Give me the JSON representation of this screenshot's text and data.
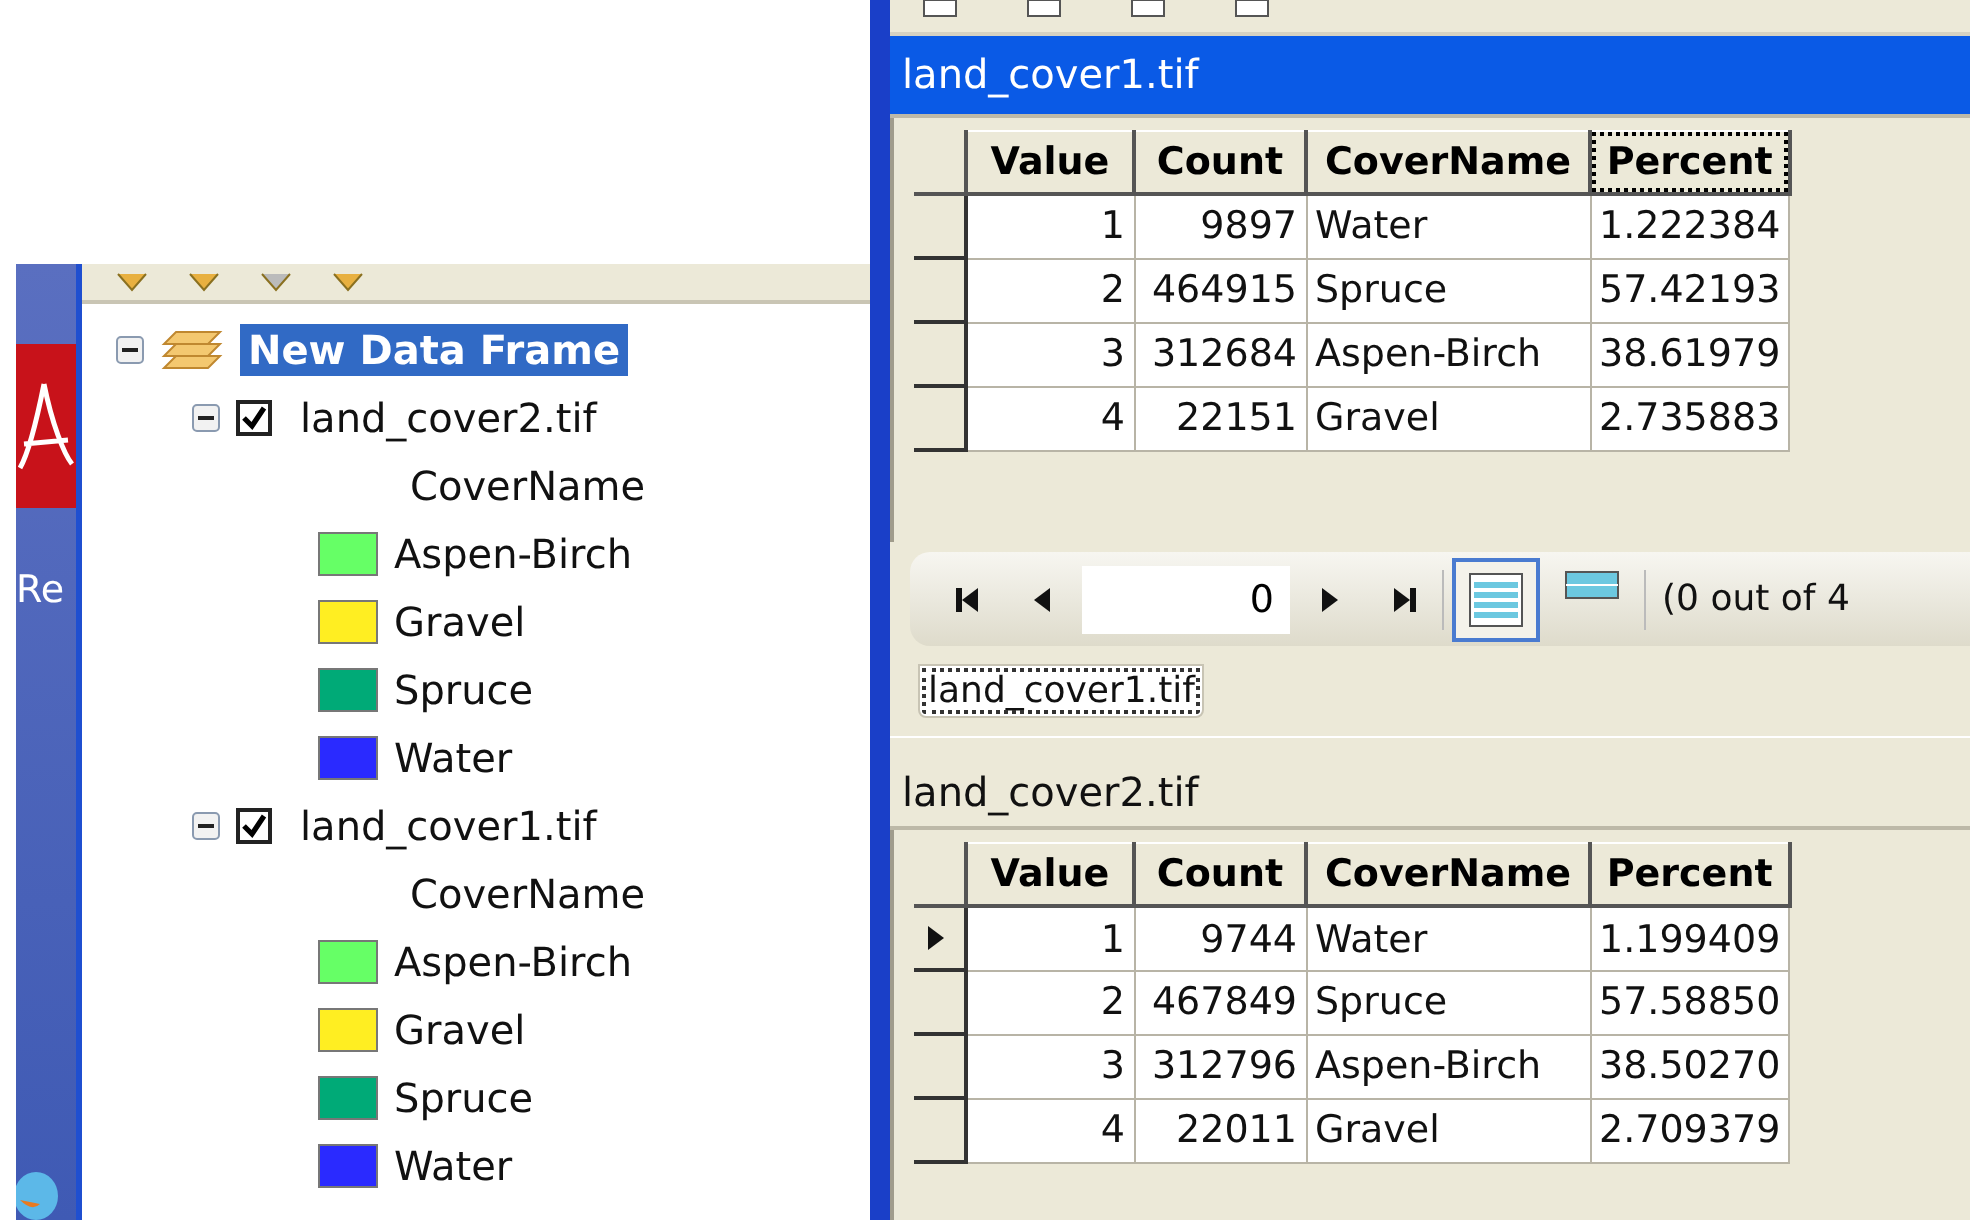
{
  "toc": {
    "desktop_label": "Re",
    "data_frame": {
      "name": "New Data Frame",
      "selected": true,
      "expanded": true
    },
    "layers": [
      {
        "name": "land_cover2.tif",
        "expanded": true,
        "checked": true,
        "field": "CoverName",
        "classes": [
          {
            "label": "Aspen-Birch",
            "color": "#66ff66"
          },
          {
            "label": "Gravel",
            "color": "#ffee22"
          },
          {
            "label": "Spruce",
            "color": "#00aa77"
          },
          {
            "label": "Water",
            "color": "#2a2aff"
          }
        ]
      },
      {
        "name": "land_cover1.tif",
        "expanded": true,
        "checked": true,
        "field": "CoverName",
        "classes": [
          {
            "label": "Aspen-Birch",
            "color": "#66ff66"
          },
          {
            "label": "Gravel",
            "color": "#ffee22"
          },
          {
            "label": "Spruce",
            "color": "#00aa77"
          },
          {
            "label": "Water",
            "color": "#2a2aff"
          }
        ]
      }
    ]
  },
  "attribute_window": {
    "upper_table": {
      "title": "land_cover1.tif",
      "active": true,
      "columns": [
        {
          "label": "Value",
          "focused": false
        },
        {
          "label": "Count",
          "focused": false
        },
        {
          "label": "CoverName",
          "focused": false
        },
        {
          "label": "Percent",
          "focused": true
        }
      ],
      "rows": [
        {
          "current": false,
          "cells": [
            "1",
            "9897",
            "Water",
            "1.222384"
          ]
        },
        {
          "current": false,
          "cells": [
            "2",
            "464915",
            "Spruce",
            "57.42193"
          ]
        },
        {
          "current": false,
          "cells": [
            "3",
            "312684",
            "Aspen-Birch",
            "38.61979"
          ]
        },
        {
          "current": false,
          "cells": [
            "4",
            "22151",
            "Gravel",
            "2.735883"
          ]
        }
      ]
    },
    "navigator": {
      "record": "0",
      "views": [
        {
          "kind": "all",
          "selected": true
        },
        {
          "kind": "selected",
          "selected": false
        }
      ],
      "status": "(0 out of 4"
    },
    "tabs": [
      {
        "label": "land_cover1.tif",
        "selected": true
      }
    ],
    "lower_table": {
      "title": "land_cover2.tif",
      "active": false,
      "columns": [
        {
          "label": "Value",
          "focused": false
        },
        {
          "label": "Count",
          "focused": false
        },
        {
          "label": "CoverName",
          "focused": false
        },
        {
          "label": "Percent",
          "focused": false
        }
      ],
      "rows": [
        {
          "current": true,
          "cells": [
            "1",
            "9744",
            "Water",
            "1.199409"
          ]
        },
        {
          "current": false,
          "cells": [
            "2",
            "467849",
            "Spruce",
            "57.58850"
          ]
        },
        {
          "current": false,
          "cells": [
            "3",
            "312796",
            "Aspen-Birch",
            "38.50270"
          ]
        },
        {
          "current": false,
          "cells": [
            "4",
            "22011",
            "Gravel",
            "2.709379"
          ]
        }
      ]
    }
  }
}
